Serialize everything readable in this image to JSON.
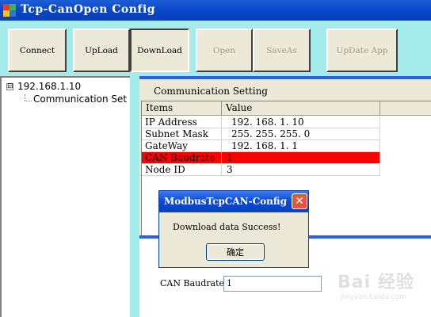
{
  "window": {
    "title": "Tcp-CanOpen Config"
  },
  "toolbar": {
    "buttons": [
      {
        "label": "Connect"
      },
      {
        "label": "UpLoad"
      },
      {
        "label": "DownLoad"
      },
      {
        "label": "Open"
      },
      {
        "label": "SaveAs"
      },
      {
        "label": "UpDate App"
      }
    ]
  },
  "tree": {
    "root": {
      "label": "192.168.1.10",
      "expander": "⊟"
    },
    "child": {
      "label": "Communication Set"
    }
  },
  "panel": {
    "caption": "Communication Setting"
  },
  "grid": {
    "headers": [
      "Items",
      "Value"
    ],
    "rows": [
      {
        "item": "IP Address",
        "value": "192. 168. 1. 10"
      },
      {
        "item": "Subnet Mask",
        "value": "255. 255. 255. 0"
      },
      {
        "item": "GateWay",
        "value": "192. 168. 1. 1"
      },
      {
        "item": "CAN Baudrate",
        "value": "1"
      },
      {
        "item": "Node ID",
        "value": "3"
      }
    ],
    "highlight_color": "#ff0000"
  },
  "dialog": {
    "title": "ModbusTcpCAN-Config",
    "message": "Download data Success!",
    "ok_label": "确定",
    "close_glyph": "✕"
  },
  "field": {
    "label": "CAN Baudrate",
    "value": "1"
  },
  "watermark": {
    "text": "Bai 经验",
    "url": "jingyan.baidu.com"
  },
  "colors": {
    "title_bar": "#0a45c8",
    "toolbar_bg": "#a4ecec",
    "panel_bg": "#ece9d8"
  }
}
